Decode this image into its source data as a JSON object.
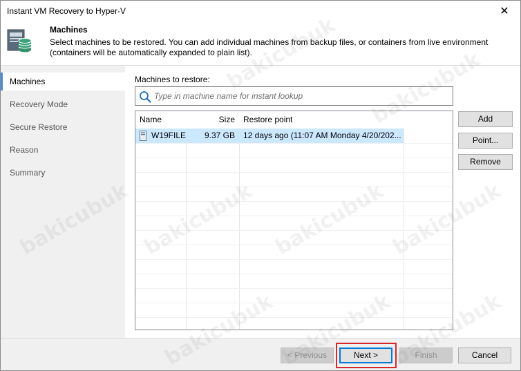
{
  "window": {
    "title": "Instant VM Recovery to Hyper-V",
    "close_glyph": "✕"
  },
  "header": {
    "title": "Machines",
    "description": "Select machines to be restored. You can add individual machines from backup files, or containers from live environment (containers will be automatically expanded to plain list)."
  },
  "sidebar": {
    "items": [
      {
        "label": "Machines",
        "active": true
      },
      {
        "label": "Recovery Mode",
        "active": false
      },
      {
        "label": "Secure Restore",
        "active": false
      },
      {
        "label": "Reason",
        "active": false
      },
      {
        "label": "Summary",
        "active": false
      }
    ]
  },
  "main": {
    "list_label": "Machines to restore:",
    "search": {
      "placeholder": "Type in machine name for instant lookup",
      "value": ""
    },
    "table": {
      "columns": [
        "Name",
        "Size",
        "Restore point"
      ],
      "rows": [
        {
          "name": "W19FILE",
          "size": "9.37 GB",
          "restore_point": "12 days ago (11:07 AM Monday 4/20/202..."
        }
      ]
    },
    "buttons": {
      "add": "Add",
      "point": "Point...",
      "remove": "Remove"
    }
  },
  "footer": {
    "previous": "< Previous",
    "next": "Next >",
    "finish": "Finish",
    "cancel": "Cancel"
  },
  "watermark": "bakicubuk",
  "colors": {
    "selection": "#cce8ff",
    "accent": "#0078d7",
    "highlight_box": "#d9262c",
    "icon_green": "#3ea37a"
  }
}
